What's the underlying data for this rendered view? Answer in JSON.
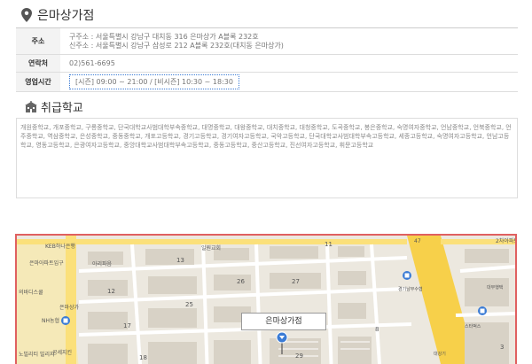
{
  "store": {
    "title": "은마상가점"
  },
  "info": {
    "address_label": "주소",
    "address_old": "구주소 : 서울특별시 강남구 대치동 316 은마상가 A블록 232호",
    "address_new": "신주소 : 서울특별시 강남구 삼성로 212 A블록 232호(대치동 은마상가)",
    "tel_label": "연락처",
    "tel_value": "02)561-6695",
    "hours_label": "영업시간",
    "hours_value": "[시즌] 09:00 ~ 21:00 / [비시즌] 10:30 ~ 18:30"
  },
  "schools": {
    "title": "취급학교",
    "list": "개원중학교, 개포중학교, 구룡중학교, 단국대학교사범대학부속중학교, 대명중학교, 대왕중학교, 대치중학교, 대청중학교, 도곡중학교, 봉은중학교, 숙명여자중학교, 언남중학교, 언북중학교, 언주중학교, 역삼중학교, 은성중학교, 중동중학교, 개포고등학교, 경기고등학교, 경기여자고등학교, 국악고등학교, 단국대학교사범대학부속고등학교, 세종고등학교, 숙명여자고등학교, 언남고등학교, 영동고등학교, 은광여자고등학교, 중앙대학교사범대학부속고등학교, 중동고등학교, 중산고등학교, 진선여자고등학교, 휘문고등학교"
  },
  "map": {
    "marker_label": "은마상가점",
    "labels": {
      "kebhana": "KEB하나은행",
      "hanmaeul": "은마아파트입구",
      "ilwon": "일원교회",
      "ahri": "아리파음",
      "nh": "NH농협",
      "eunmasangga": "은마상가",
      "uibeo": "의바디스쿨",
      "noblerity": "노빌리티\n빌리지",
      "gongse": "공세지킨",
      "gyeonggi": "경기남부수협",
      "daebu": "대부행택",
      "chaya": "2차아파트",
      "seuta": "스타벅스",
      "daegang": "대강기",
      "num_11": "11",
      "num_12": "12",
      "num_13": "13",
      "num_17": "17",
      "num_18": "18",
      "num_25": "25",
      "num_26": "26",
      "num_27": "27",
      "num_29": "29",
      "num_8": "8",
      "num_3": "3",
      "num_47": "47"
    }
  },
  "colors": {
    "accent_blue": "#3a7bd5",
    "map_border": "#e06060",
    "road_yellow": "#f7d04a"
  }
}
